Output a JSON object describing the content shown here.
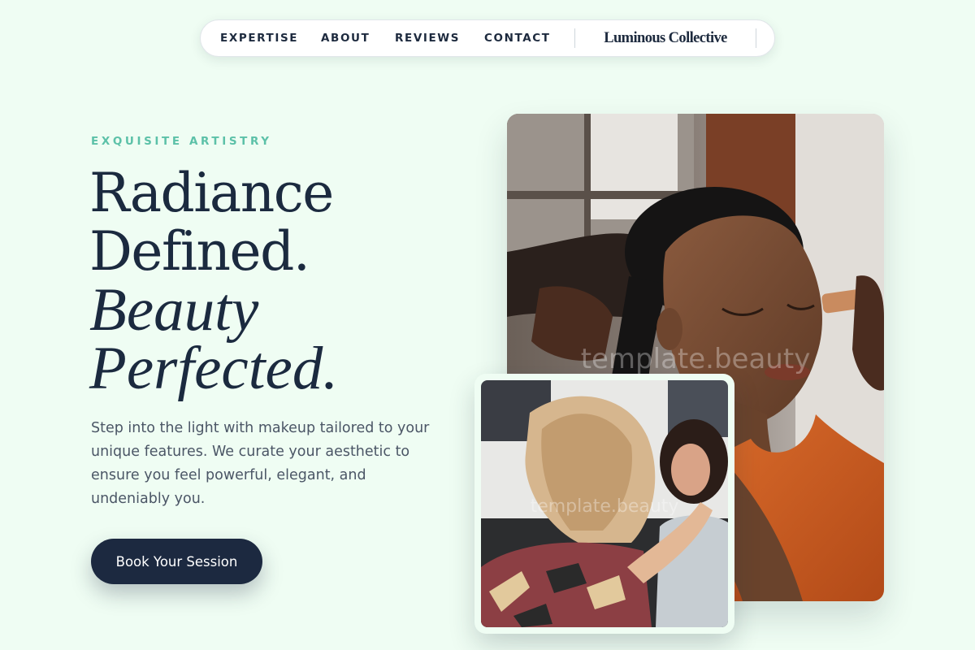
{
  "nav": {
    "links": [
      "EXPERTISE",
      "ABOUT",
      "REVIEWS",
      "CONTACT"
    ],
    "brand": "Luminous Collective"
  },
  "hero": {
    "eyebrow": "EXQUISITE ARTISTRY",
    "headline_line1": "Radiance",
    "headline_line2": "Defined.",
    "headline_italic_line1": "Beauty",
    "headline_italic_line2": "Perfected.",
    "lead": "Step into the light with makeup tailored to your unique features. We curate your aesthetic to ensure you feel powerful, elegant, and undeniably you.",
    "cta_label": "Book Your Session"
  },
  "images": {
    "main_watermark": "template.beauty",
    "small_watermark": "template.beauty"
  },
  "colors": {
    "background": "#effdf3",
    "accent": "#5cc1a8",
    "primary_dark": "#1c2940"
  }
}
